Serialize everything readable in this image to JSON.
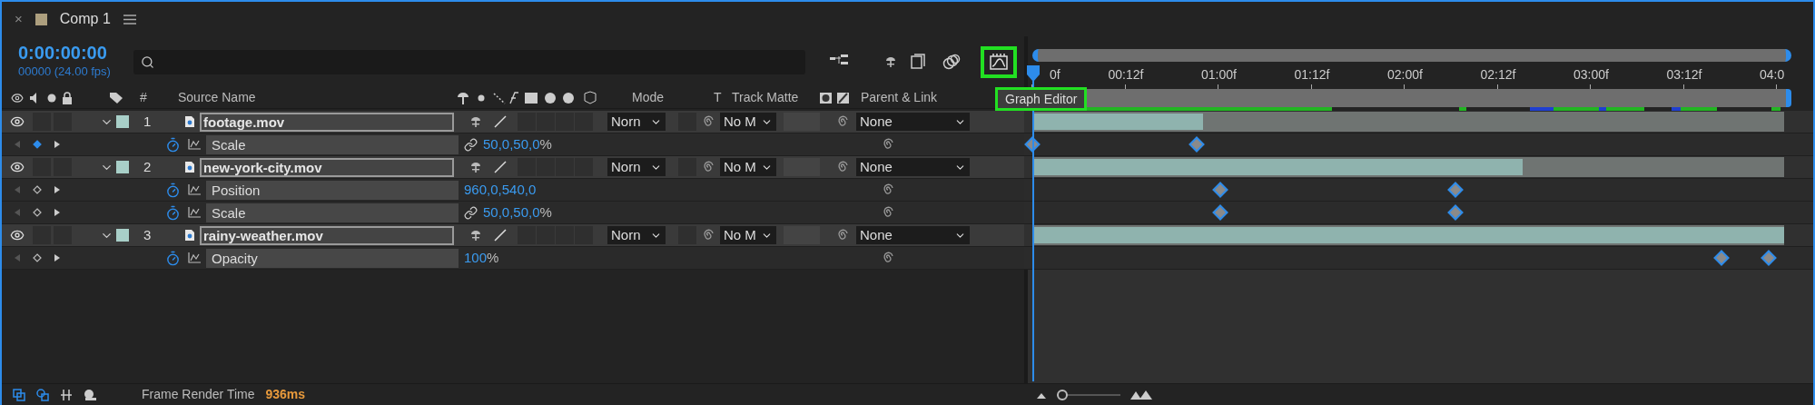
{
  "tab": {
    "close": "×",
    "title": "Comp 1"
  },
  "zoom": {
    "level": 0
  },
  "timecode": {
    "time": "0:00:00:00",
    "frames": "00000 (24.00 fps)"
  },
  "graph_editor": {
    "highlighted": true,
    "tooltip": "Graph Editor"
  },
  "columns": {
    "number": "#",
    "source": "Source Name",
    "mode": "Mode",
    "t": "T",
    "matte": "Track Matte",
    "parent": "Parent & Link"
  },
  "ruler": {
    "labels": [
      "0f",
      "00:12f",
      "01:00f",
      "01:12f",
      "02:00f",
      "02:12f",
      "03:00f",
      "03:12f",
      "04:0"
    ]
  },
  "layers": [
    {
      "number": "1",
      "name": "footage.mov",
      "mode": "Norn",
      "matte": "No M",
      "parent": "None",
      "expanded": true,
      "visible": true,
      "level": 0.227,
      "properties": [
        {
          "name": "Scale",
          "value": "50,0,50,0",
          "unit": "%",
          "linked": true,
          "at_keyframe": true,
          "keyframes": [
            {
              "level": 0
            },
            {
              "level": 0.219
            }
          ]
        }
      ]
    },
    {
      "number": "2",
      "name": "new-york-city.mov",
      "mode": "Norn",
      "matte": "No M",
      "parent": "None",
      "expanded": true,
      "visible": true,
      "level": 0.652,
      "properties": [
        {
          "name": "Position",
          "value": "960,0,540,0",
          "linked": false,
          "at_keyframe": false,
          "keyframes": [
            {
              "level": 0.25
            },
            {
              "level": 0.5625
            }
          ]
        },
        {
          "name": "Scale",
          "value": "50,0,50,0",
          "unit": "%",
          "linked": true,
          "at_keyframe": false,
          "keyframes": [
            {
              "level": 0.25
            },
            {
              "level": 0.5625
            }
          ]
        }
      ]
    },
    {
      "number": "3",
      "name": "rainy-weather.mov",
      "mode": "Norn",
      "matte": "No M",
      "parent": "None",
      "expanded": true,
      "visible": true,
      "level": 1,
      "properties": [
        {
          "name": "Opacity",
          "value": "100",
          "unit": "%",
          "linked": false,
          "at_keyframe": false,
          "keyframes": [
            {
              "level": 0.917
            },
            {
              "level": 0.979
            }
          ]
        }
      ]
    }
  ],
  "status": {
    "label": "Frame Render Time",
    "value": "936ms"
  }
}
